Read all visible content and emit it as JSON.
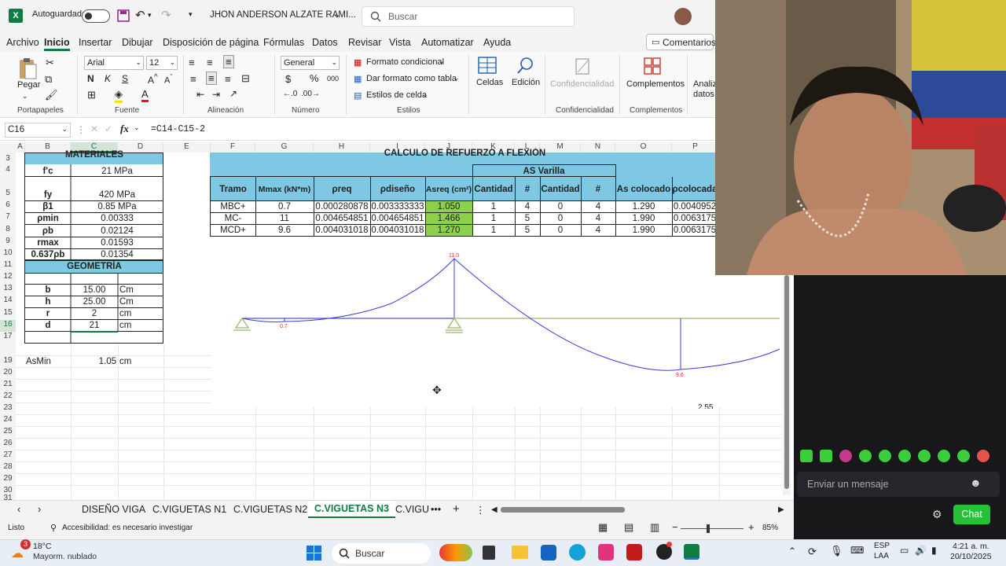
{
  "titlebar": {
    "autosave_label": "Autoguardado",
    "user_name": "JHON ANDERSON ALZATE RAMI...",
    "search_placeholder": "Buscar"
  },
  "menu": {
    "items": [
      "Archivo",
      "Inicio",
      "Insertar",
      "Dibujar",
      "Disposición de página",
      "Fórmulas",
      "Datos",
      "Revisar",
      "Vista",
      "Automatizar",
      "Ayuda"
    ],
    "active": "Inicio",
    "comments_button": "Comentarios"
  },
  "ribbon": {
    "paste_label": "Pegar",
    "font_name": "Arial",
    "font_size": "12",
    "number_format": "General",
    "conditional_format": "Formato condicional",
    "table_format": "Dar formato como tabla",
    "cell_styles": "Estilos de celda",
    "cells_label": "Celdas",
    "editing_label": "Edición",
    "confidentiality_label": "Confidencialidad",
    "addins_label": "Complementos",
    "analyze_label": "Analiz datos",
    "groups": {
      "clipboard": "Portapapeles",
      "font": "Fuente",
      "alignment": "Alineación",
      "number": "Número",
      "styles": "Estilos",
      "confidentiality": "Confidencialidad",
      "addins": "Complementos"
    }
  },
  "formula_bar": {
    "name_box": "C16",
    "fx": "fx",
    "formula": "=C14-C15-2"
  },
  "columns": [
    "A",
    "B",
    "C",
    "D",
    "E",
    "F",
    "G",
    "H",
    "I",
    "J",
    "K",
    "L",
    "M",
    "N",
    "O",
    "P"
  ],
  "rows": [
    "3",
    "4",
    "5",
    "6",
    "7",
    "8",
    "9",
    "10",
    "11",
    "12",
    "13",
    "14",
    "15",
    "16",
    "17",
    "19",
    "20",
    "21",
    "22",
    "23",
    "24",
    "25",
    "26",
    "27",
    "28",
    "29",
    "30",
    "31"
  ],
  "materiales": {
    "title": "MATERIALES",
    "rows": [
      {
        "label": "f'c",
        "value": "21 MPa"
      },
      {
        "label": "fy",
        "value": "420 MPa"
      },
      {
        "label": "β1",
        "value": "0.85 MPa"
      },
      {
        "label": "ρmin",
        "value": "0.00333"
      },
      {
        "label": "ρb",
        "value": "0.02124"
      },
      {
        "label": "rmax",
        "value": "0.01593"
      },
      {
        "label": "0.637ρb",
        "value": "0.01354"
      }
    ]
  },
  "geometria": {
    "title": "GEOMETRÍA",
    "rows": [
      {
        "label": "b",
        "value": "15.00",
        "unit": "Cm"
      },
      {
        "label": "h",
        "value": "25.00",
        "unit": "Cm"
      },
      {
        "label": "r",
        "value": "2",
        "unit": "cm"
      },
      {
        "label": "d",
        "value": "21",
        "unit": "cm"
      }
    ]
  },
  "asmin": {
    "label": "AsMin",
    "value": "1.05",
    "unit": "cm"
  },
  "flexion": {
    "title": "CALCULO DE REFUERZO A FLEXIÓN",
    "as_varilla": "AS Varilla",
    "headers": [
      "Tramo",
      "Mmax (kN*m)",
      "ρreq",
      "ρdiseño",
      "Asreq (cm²)",
      "Cantidad",
      "#",
      "Cantidad",
      "#",
      "As colocado",
      "ρcolocada"
    ],
    "rows": [
      [
        "MBC+",
        "0.7",
        "0.000280878",
        "0.003333333",
        "1.050",
        "1",
        "4",
        "0",
        "4",
        "1.290",
        "0.0040952"
      ],
      [
        "MC-",
        "11",
        "0.004654851",
        "0.004654851",
        "1.466",
        "1",
        "5",
        "0",
        "4",
        "1.990",
        "0.0063175"
      ],
      [
        "MCD+",
        "9.6",
        "0.004031018",
        "0.004031018",
        "1.270",
        "1",
        "5",
        "0",
        "4",
        "1.990",
        "0.0063175"
      ]
    ]
  },
  "chart_data": {
    "type": "line",
    "title": "",
    "labels": [
      "0.7",
      "11.0",
      "9.6"
    ],
    "partial_label": "2.55",
    "color": "#3d3dd8"
  },
  "sheets": {
    "tabs": [
      "DISEÑO VIGA",
      "C.VIGUETAS N1",
      "C.VIGUETAS N2",
      "C.VIGUETAS N3",
      "C.VIGU"
    ],
    "active": "C.VIGUETAS N3"
  },
  "status": {
    "ready": "Listo",
    "accessibility": "Accesibilidad: es necesario investigar",
    "zoom": "85%"
  },
  "chat": {
    "placeholder": "Enviar un mensaje",
    "button": "Chat"
  },
  "taskbar": {
    "temperature": "18°C",
    "weather": "Mayorm. nublado",
    "weather_badge": "3",
    "search": "Buscar",
    "lang": "ESP",
    "lang2": "LAA",
    "time": "4:21 a. m.",
    "date": "20/10/2025"
  }
}
